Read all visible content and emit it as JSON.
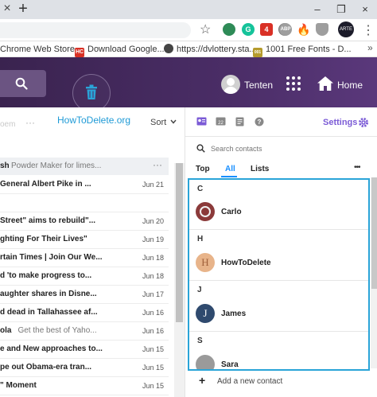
{
  "browser": {
    "tab_close": "×",
    "new_tab": "+",
    "window_controls": [
      "–",
      "❐",
      "×"
    ],
    "star": "☆",
    "extensions": [
      {
        "name": "green-extension-icon",
        "color": "#2e8b57",
        "text": ""
      },
      {
        "name": "grammarly-icon",
        "color": "#15c39a",
        "text": "G"
      },
      {
        "name": "red-badge-extension-icon",
        "color": "#d93025",
        "text": "4"
      },
      {
        "name": "circle-extension-icon",
        "color": "#777777",
        "text": ""
      },
      {
        "name": "adblock-icon",
        "color": "#9e9e9e",
        "text": "ABP"
      },
      {
        "name": "fire-extension-icon",
        "color": "#ff6d00",
        "text": ""
      },
      {
        "name": "shield-extension-icon",
        "color": "#9e9e9e",
        "text": ""
      }
    ],
    "profile_badge": "ARTE",
    "menu": "⋮"
  },
  "bookmarks": [
    {
      "label": "Chrome Web Store...",
      "icon_color": "#ffffff",
      "icon_text": ""
    },
    {
      "label": "Download Google...",
      "icon_color": "#d93025",
      "icon_text": "HC"
    },
    {
      "label": "https://dvlottery.sta...",
      "icon_color": "#444444",
      "icon_text": ""
    },
    {
      "label": "1001 Free Fonts - D...",
      "icon_color": "#b59b2d",
      "icon_text": "001"
    }
  ],
  "header": {
    "user_name": "Tenten",
    "home_label": "Home",
    "accent": "#4a2d66"
  },
  "left_toolbar": {
    "faded_label": "oem",
    "more": "···",
    "brand": "HowToDelete.org",
    "sort_label": "Sort",
    "sort_arrow": "⌄"
  },
  "mail": {
    "pinned": {
      "subject": "sh",
      "snippet": "Powder Maker for limes...",
      "more": "···"
    },
    "rows": [
      {
        "subject": "General Albert Pike in ...",
        "snippet": "",
        "date": "Jun 21"
      },
      {
        "subject": "",
        "snippet": "",
        "date": ""
      },
      {
        "subject": "Street\" aims to rebuild\"...",
        "snippet": "",
        "date": "Jun 20"
      },
      {
        "subject": "ghting For Their Lives\"",
        "snippet": "",
        "date": "Jun 19"
      },
      {
        "subject": "rtain Times | Join Our We...",
        "snippet": "",
        "date": "Jun 18"
      },
      {
        "subject": "d 'to make progress to...",
        "snippet": "",
        "date": "Jun 18"
      },
      {
        "subject": "aughter shares in Disne...",
        "snippet": "",
        "date": "Jun 17"
      },
      {
        "subject": "d dead in Tallahassee af...",
        "snippet": "",
        "date": "Jun 16"
      },
      {
        "subject": "ola",
        "snippet": "Get the best of Yaho...",
        "date": "Jun 16"
      },
      {
        "subject": "e and New approaches to...",
        "snippet": "",
        "date": "Jun 15"
      },
      {
        "subject": "pe out Obama-era tran...",
        "snippet": "",
        "date": "Jun 15"
      },
      {
        "subject": "\" Moment",
        "snippet": "",
        "date": "Jun 15"
      }
    ]
  },
  "right_panel": {
    "settings_label": "Settings",
    "search_placeholder": "Search contacts",
    "tabs": [
      "Top",
      "All",
      "Lists"
    ],
    "more": "•••",
    "add_contact": "Add a new contact",
    "add_icon": "+",
    "accent": "#7b5bd6"
  },
  "contacts": [
    {
      "letter": "C",
      "name": "Carlo",
      "avatar_color": "#8b3a3a"
    },
    {
      "letter": "H",
      "name": "HowToDelete",
      "avatar_color": "#e8b48a"
    },
    {
      "letter": "J",
      "name": "James",
      "avatar_color": "#2f4a6e"
    },
    {
      "letter": "S",
      "name": "Sara",
      "avatar_color": "#9a9a9a"
    }
  ]
}
